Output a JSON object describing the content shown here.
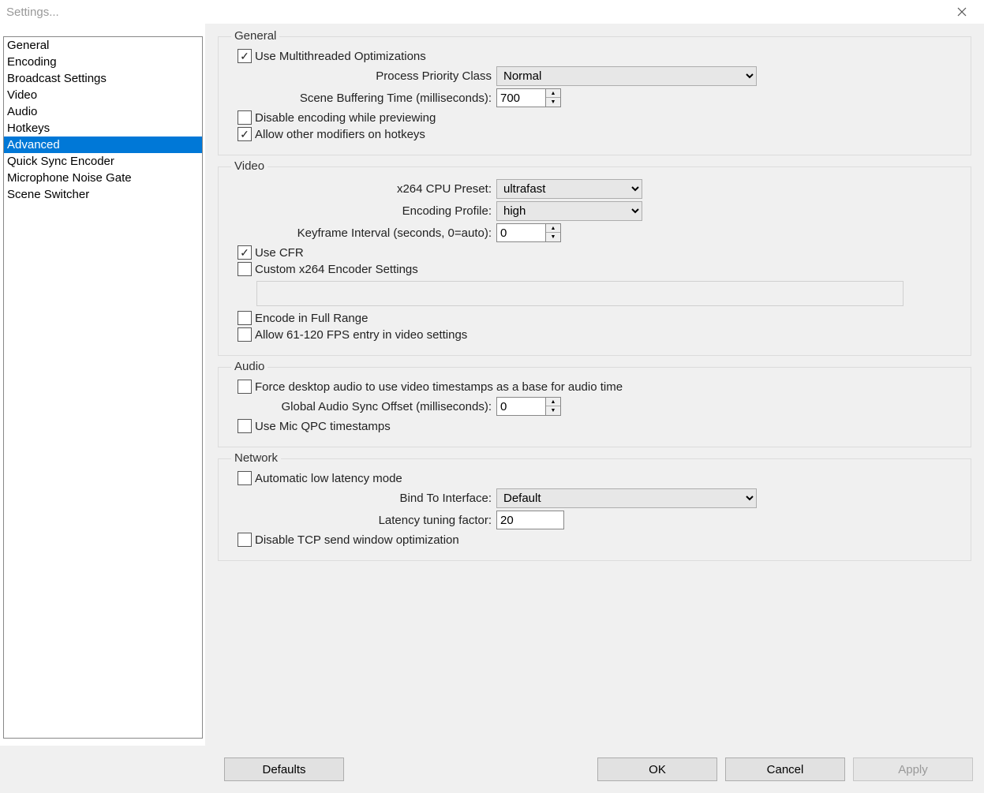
{
  "window": {
    "title": "Settings..."
  },
  "sidebar": {
    "items": [
      {
        "label": "General"
      },
      {
        "label": "Encoding"
      },
      {
        "label": "Broadcast Settings"
      },
      {
        "label": "Video"
      },
      {
        "label": "Audio"
      },
      {
        "label": "Hotkeys"
      },
      {
        "label": "Advanced",
        "selected": true
      },
      {
        "label": "Quick Sync Encoder"
      },
      {
        "label": "Microphone Noise Gate"
      },
      {
        "label": "Scene Switcher"
      }
    ]
  },
  "groups": {
    "general": {
      "title": "General",
      "use_multithreaded": "Use Multithreaded Optimizations",
      "process_priority_label": "Process Priority Class",
      "process_priority_value": "Normal",
      "scene_buffering_label": "Scene Buffering Time (milliseconds):",
      "scene_buffering_value": "700",
      "disable_encoding_preview": "Disable encoding while previewing",
      "allow_other_modifiers": "Allow other modifiers on hotkeys"
    },
    "video": {
      "title": "Video",
      "x264_preset_label": "x264 CPU Preset:",
      "x264_preset_value": "ultrafast",
      "encoding_profile_label": "Encoding Profile:",
      "encoding_profile_value": "high",
      "keyframe_label": "Keyframe Interval (seconds, 0=auto):",
      "keyframe_value": "0",
      "use_cfr": "Use CFR",
      "custom_x264": "Custom x264 Encoder Settings",
      "encode_full_range": "Encode in Full Range",
      "allow_61_120": "Allow 61-120 FPS entry in video settings"
    },
    "audio": {
      "title": "Audio",
      "force_desktop": "Force desktop audio to use video timestamps as a base for audio time",
      "global_sync_label": "Global Audio Sync Offset (milliseconds):",
      "global_sync_value": "0",
      "use_mic_qpc": "Use Mic QPC timestamps"
    },
    "network": {
      "title": "Network",
      "auto_low_latency": "Automatic low latency mode",
      "bind_label": "Bind To Interface:",
      "bind_value": "Default",
      "latency_label": "Latency tuning factor:",
      "latency_value": "20",
      "disable_tcp": "Disable TCP send window optimization"
    }
  },
  "footer": {
    "defaults": "Defaults",
    "ok": "OK",
    "cancel": "Cancel",
    "apply": "Apply"
  }
}
